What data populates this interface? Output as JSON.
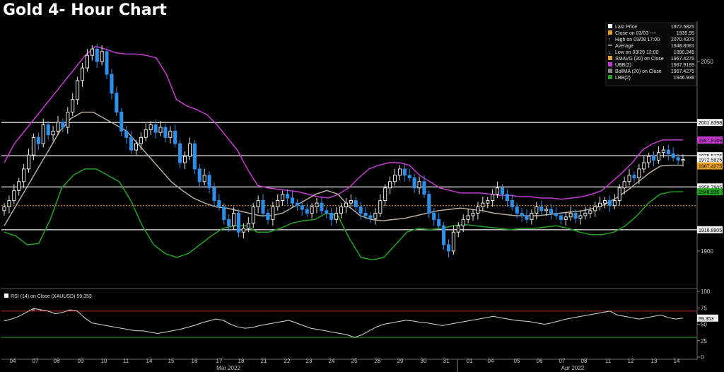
{
  "title": "Gold 4- Hour Chart",
  "colors": {
    "background": "#000000",
    "candle_up": "#e8e8e8",
    "candle_down": "#2f8fe8",
    "upper_band": "#c43bd0",
    "lower_band": "#21a321",
    "sma": "#b8ad9c",
    "levels": "#d9d9d9",
    "close_line": "#e8a020",
    "rsi_line": "#d8d8d8",
    "rsi_upper": "#c22a2a",
    "rsi_lower": "#21a321"
  },
  "chart_data": [
    {
      "type": "candlestick",
      "title": "Gold 4- Hour Chart",
      "ylim": [
        1872,
        2082
      ],
      "y_ticks": [
        1900,
        2050
      ],
      "x_ticks_top": [
        "04",
        "07",
        "08",
        "09",
        "10",
        "11",
        "14",
        "15",
        "16",
        "17",
        "18",
        "21",
        "22",
        "23",
        "24",
        "25",
        "28",
        "29",
        "30",
        "31",
        "01",
        "04",
        "05",
        "06",
        "07",
        "08",
        "11",
        "12",
        "13",
        "14"
      ],
      "x_ticks_bottom": [
        "Mar 2022",
        "Apr 2022"
      ],
      "legend": [
        {
          "label": "Last Price",
          "value": "1972.5825",
          "icon": "square",
          "color": "#ffffff"
        },
        {
          "label": "Close on 03/03 ----",
          "value": "1935.95",
          "icon": "square",
          "color": "#e8a020"
        },
        {
          "label": "High on 03/08 17:00",
          "value": "2070.4375",
          "icon": "up-arrow",
          "color": "#ffffff"
        },
        {
          "label": "Average",
          "value": "1948.8081",
          "icon": "dash",
          "color": "#ffffff"
        },
        {
          "label": "Low on 03/29 12:00",
          "value": "1890.245",
          "icon": "down-arrow",
          "color": "#ffffff"
        },
        {
          "label": "SMAVG (20)  on Close",
          "value": "1967.4275",
          "icon": "square",
          "color": "#e8a020"
        },
        {
          "label": "UBB(2)",
          "value": "1987.9189",
          "icon": "square",
          "color": "#c43bd0"
        },
        {
          "label": "BollMA (20)  on Close",
          "value": "1967.4275",
          "icon": "square",
          "color": "#888888"
        },
        {
          "label": "LBB(2)",
          "value": "1946.936",
          "icon": "square",
          "color": "#21a321"
        }
      ],
      "levels": [
        {
          "value": 2001.8398,
          "label": "2001.8398"
        },
        {
          "value": 1975.5176,
          "label": "1975.5176"
        },
        {
          "value": 1950.7905,
          "label": "1950.7905"
        },
        {
          "value": 1916.8905,
          "label": "1916.8905"
        }
      ],
      "level_labels_extra": [
        {
          "value": 1987.9189,
          "label": "1987.9189",
          "color": "#c43bd0"
        },
        {
          "value": 1972.5825,
          "label": "1972.5825",
          "color": "#ffffff"
        },
        {
          "value": 1967.4275,
          "label": "1967.4275",
          "color": "#e8a020"
        },
        {
          "value": 1946.936,
          "label": "1946.936",
          "color": "#21a321"
        }
      ],
      "close_ref": 1935.95,
      "series": [
        {
          "name": "Price",
          "kind": "candles",
          "closes": [
            1935,
            1940,
            1948,
            1955,
            1965,
            1976,
            1990,
            1985,
            2000,
            1992,
            1995,
            2002,
            1998,
            2010,
            2020,
            2035,
            2045,
            2055,
            2060,
            2050,
            2058,
            2040,
            2025,
            2010,
            1995,
            1990,
            1980,
            1985,
            1990,
            1996,
            2000,
            1994,
            1998,
            1990,
            1995,
            1985,
            1970,
            1975,
            1985,
            1965,
            1955,
            1960,
            1950,
            1940,
            1935,
            1925,
            1920,
            1930,
            1915,
            1918,
            1922,
            1935,
            1940,
            1930,
            1925,
            1935,
            1940,
            1945,
            1942,
            1938,
            1936,
            1933,
            1930,
            1935,
            1938,
            1932,
            1930,
            1925,
            1930,
            1935,
            1938,
            1940,
            1935,
            1930,
            1928,
            1926,
            1930,
            1940,
            1950,
            1955,
            1960,
            1965,
            1960,
            1958,
            1950,
            1955,
            1945,
            1930,
            1925,
            1920,
            1905,
            1900,
            1915,
            1920,
            1925,
            1928,
            1930,
            1935,
            1938,
            1940,
            1945,
            1950,
            1945,
            1940,
            1935,
            1930,
            1928,
            1925,
            1930,
            1935,
            1932,
            1933,
            1930,
            1928,
            1925,
            1927,
            1930,
            1926,
            1928,
            1930,
            1932,
            1935,
            1938,
            1940,
            1936,
            1940,
            1950,
            1955,
            1960,
            1958,
            1965,
            1970,
            1975,
            1972,
            1978,
            1980,
            1977,
            1974,
            1972,
            1972.58
          ]
        },
        {
          "name": "UBB(2)",
          "kind": "line",
          "color": "#c43bd0",
          "values": [
            1970,
            1985,
            1995,
            2005,
            2015,
            2025,
            2035,
            2045,
            2055,
            2062,
            2060,
            2057,
            2056,
            2056,
            2055,
            2053,
            2040,
            2020,
            2015,
            2012,
            2008,
            2000,
            1990,
            1980,
            1965,
            1952,
            1950,
            1949,
            1948,
            1947,
            1945,
            1943,
            1942,
            1945,
            1950,
            1958,
            1965,
            1968,
            1970,
            1970,
            1968,
            1960,
            1955,
            1950,
            1948,
            1946,
            1946,
            1946,
            1945,
            1944,
            1944,
            1943,
            1943,
            1942,
            1942,
            1941,
            1942,
            1943,
            1945,
            1948,
            1955,
            1962,
            1970,
            1980,
            1985,
            1987.92,
            1988,
            1988
          ]
        },
        {
          "name": "SMA(20)",
          "kind": "line",
          "color": "#b8ad9c",
          "values": [
            1920,
            1935,
            1950,
            1965,
            1980,
            1995,
            2005,
            2010,
            2010,
            2005,
            2000,
            1995,
            1985,
            1975,
            1965,
            1955,
            1948,
            1942,
            1938,
            1935,
            1934,
            1932,
            1930,
            1928,
            1928,
            1930,
            1935,
            1940,
            1945,
            1948,
            1945,
            1935,
            1928,
            1925,
            1924,
            1925,
            1926,
            1928,
            1930,
            1932,
            1933,
            1934,
            1933,
            1932,
            1930,
            1929,
            1928,
            1928,
            1928,
            1929,
            1930,
            1931,
            1932,
            1934,
            1937,
            1942,
            1948,
            1955,
            1962,
            1967.43,
            1968,
            1968
          ]
        },
        {
          "name": "LBB(2)",
          "kind": "line",
          "color": "#21a321",
          "values": [
            1915,
            1912,
            1905,
            1906,
            1925,
            1950,
            1960,
            1965,
            1965,
            1960,
            1955,
            1940,
            1920,
            1905,
            1898,
            1895,
            1898,
            1905,
            1912,
            1918,
            1920,
            1920,
            1915,
            1915,
            1918,
            1922,
            1924,
            1925,
            1930,
            1928,
            1910,
            1895,
            1893,
            1895,
            1905,
            1915,
            1918,
            1917,
            1918,
            1920,
            1921,
            1920,
            1919,
            1918,
            1917,
            1918,
            1918,
            1919,
            1920,
            1918,
            1915,
            1913,
            1913,
            1915,
            1920,
            1928,
            1938,
            1945,
            1946.94,
            1947
          ]
        }
      ]
    },
    {
      "type": "line",
      "title": "RSI (14)  on Close (XAUUSD) 59.353",
      "legend_label": "RSI (14)  on Close (XAUUSD) 59.353",
      "ylim": [
        0,
        100
      ],
      "y_ticks": [
        0,
        25,
        50,
        75,
        100
      ],
      "value_label": "59.353",
      "upper": 70,
      "lower": 30,
      "values": [
        55,
        58,
        62,
        68,
        74,
        72,
        70,
        66,
        68,
        72,
        70,
        60,
        52,
        50,
        48,
        46,
        44,
        42,
        40,
        40,
        38,
        36,
        38,
        40,
        42,
        45,
        48,
        52,
        55,
        58,
        56,
        50,
        46,
        44,
        45,
        48,
        50,
        52,
        54,
        56,
        52,
        48,
        44,
        42,
        40,
        38,
        36,
        34,
        30,
        34,
        40,
        46,
        50,
        52,
        54,
        56,
        55,
        53,
        52,
        50,
        48,
        50,
        52,
        54,
        56,
        58,
        60,
        62,
        60,
        58,
        56,
        55,
        54,
        52,
        50,
        52,
        55,
        58,
        60,
        62,
        64,
        66,
        68,
        70,
        64,
        62,
        60,
        58,
        60,
        62,
        64,
        60,
        58,
        59.353
      ]
    }
  ]
}
